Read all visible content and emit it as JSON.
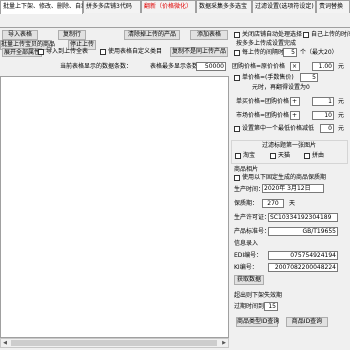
{
  "tabs_row1": [
    {
      "label": "批量上下架、修改、删除、自动回复",
      "active": true
    },
    {
      "label": "拼多多店铺3代码",
      "active": false
    },
    {
      "label": "翻新（价格微化）",
      "active": false,
      "highlight": true
    },
    {
      "label": "数据采集多多选宝",
      "active": false
    },
    {
      "label": "过滤设置(选项符设定)",
      "active": false
    },
    {
      "label": "责词替换",
      "active": false
    }
  ],
  "tabs_row2": [
    {
      "label": "设置",
      "active": false
    }
  ],
  "toolbar": {
    "import_table_label": "导入表格",
    "copy_row_label": "复制行",
    "upload_products_label": "批量上传宝贝的商品",
    "stop_upload_label": "停止上传",
    "clear_uploaded_label": "清除掉上传的产品",
    "add_table_label": "添加表格",
    "expand_label": "展开全部属性",
    "import_upload_check_label": "导入到上传全表",
    "use_custom_category_label": "使用表格自定义类目",
    "export_unfinished_label": "复制不是同上传产品",
    "status_text": "当前表格显示的数据条数：",
    "max_display_label": "表格最多显示条数：",
    "max_display_value": "50000"
  },
  "right_panel": {
    "auto_close_label": "关闭店铺自动处理选择",
    "auto_upload_label": "自己上传的时间",
    "upload_settings_label": "按多多上传成设置完成",
    "multi_shop_label": "拼多多店铺开启",
    "price_range_label": "每上传的间隔时间",
    "price_range_value": "5",
    "price_range_unit": "个（最大20）",
    "group_price_label": "团购价格=原价价格",
    "group_price_multiplier": "1.00",
    "group_price_unit": "元",
    "single_price_label": "单价格=(手数售价)",
    "single_price_value": "5",
    "single_price_unit": "元",
    "price_tip": "元时，再翻得设置为0",
    "market_price_label": "单买价格=团购价格",
    "market_price_value": "1",
    "market_price_unit": "元",
    "market_price2_label": "市场价格=团购价格",
    "market_price2_value": "10",
    "market_price2_unit": "元",
    "set_unit_label": "设置第中一个最低价格减低",
    "set_unit_value": "0",
    "set_unit_unit": "元",
    "filter_heading": "过滤标题第一张图片",
    "filter_opts": [
      "淘宝",
      "天猫",
      "拼由"
    ],
    "product_image_label": "商品相片",
    "use_fixed_label": "使用以下固定生成的商品保质期",
    "prod_date_label": "生产时间：",
    "prod_date_value": "2020年 3月12日",
    "shelf_life_label": "保质期：",
    "shelf_life_value": "270",
    "shelf_life_unit": "天",
    "license_label": "生产许可证：",
    "license_value": "SC10334192304189",
    "standard_label": "产品标准号：",
    "standard_value": "GB/T19655",
    "info_entry_label": "信息录入",
    "edi_label": "EDI编号：",
    "edi_value": "075754924194",
    "ki_label": "KI编号：",
    "ki_value": "2007082200048224",
    "get_data_label": "获取数据",
    "expire_label": "超出则下架失效期",
    "expire_time_label": "过期时间到",
    "expire_value": "15",
    "goods_id_button": "商品类型ID查询",
    "goods_code_button": "商品ID查询"
  }
}
